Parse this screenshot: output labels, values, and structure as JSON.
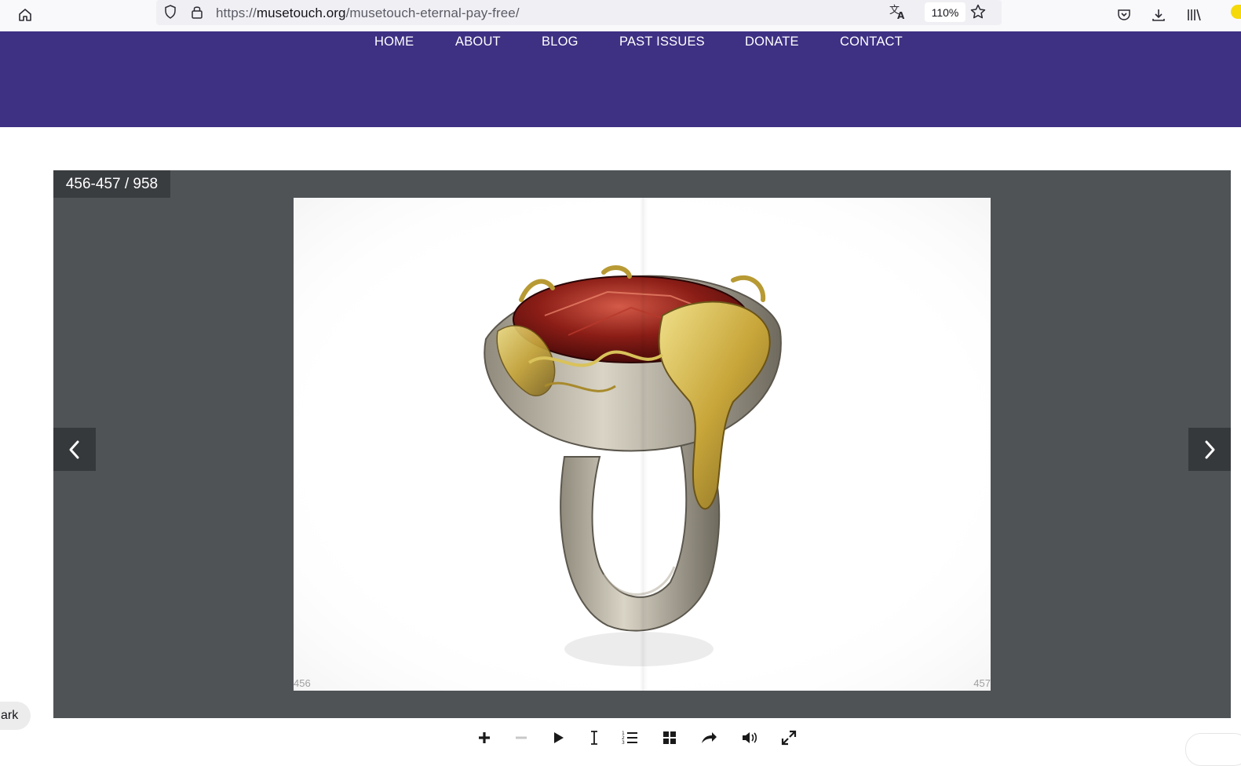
{
  "browser": {
    "url_scheme": "https://",
    "url_domain": "musetouch.org",
    "url_path": "/musetouch-eternal-pay-free/",
    "zoom": "110%"
  },
  "nav": {
    "items": [
      "HOME",
      "ABOUT",
      "BLOG",
      "PAST ISSUES",
      "DONATE",
      "CONTACT"
    ]
  },
  "viewer": {
    "page_counter": "456-457 / 958",
    "left_page_number": "456",
    "right_page_number": "457",
    "spread_image": "ring-with-red-gemstone"
  },
  "side_pill": {
    "label": "ark"
  },
  "colors": {
    "nav_bg": "#3e3083",
    "viewer_bg": "#4f5356"
  }
}
